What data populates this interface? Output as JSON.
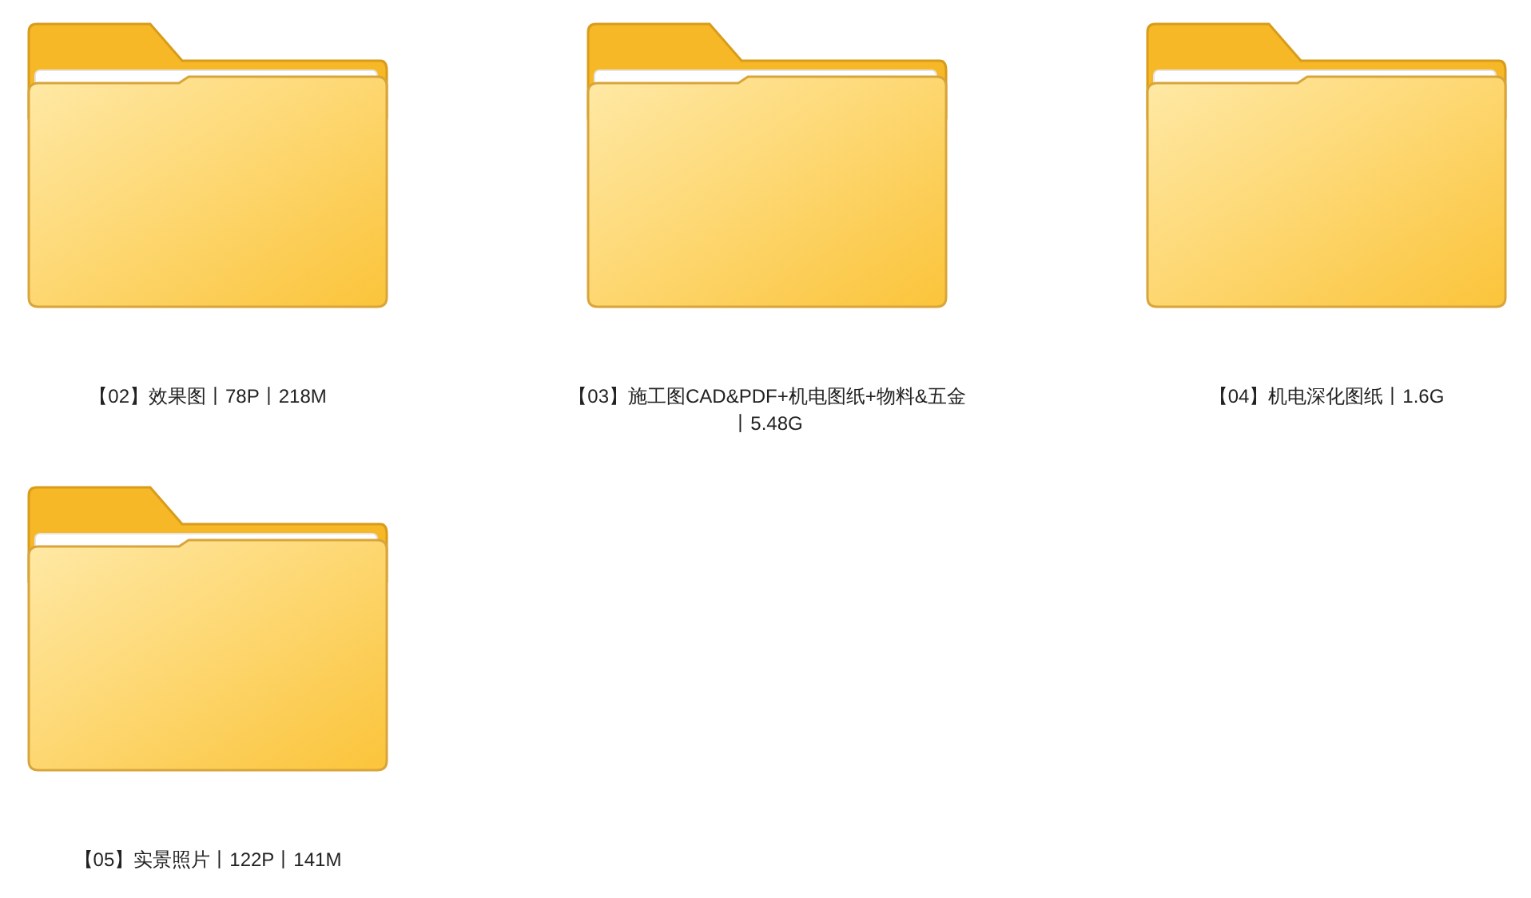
{
  "folders": [
    {
      "name": "【02】效果图丨78P丨218M"
    },
    {
      "name": "【03】施工图CAD&PDF+机电图纸+物料&五金丨5.48G"
    },
    {
      "name": "【04】机电深化图纸丨1.6G"
    },
    {
      "name": "【05】实景照片丨122P丨141M"
    }
  ]
}
